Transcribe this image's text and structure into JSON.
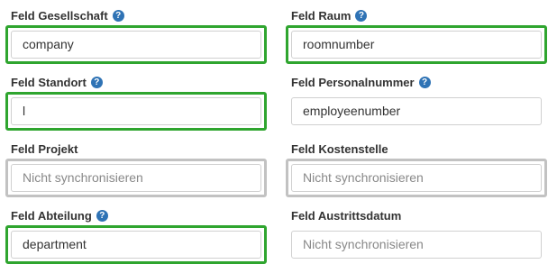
{
  "help_glyph": "?",
  "fields": {
    "gesellschaft": {
      "label": "Feld Gesellschaft",
      "value": "company",
      "has_help": true,
      "highlight": "green"
    },
    "raum": {
      "label": "Feld Raum",
      "value": "roomnumber",
      "has_help": true,
      "highlight": "green"
    },
    "standort": {
      "label": "Feld Standort",
      "value": "l",
      "has_help": true,
      "highlight": "green"
    },
    "personalnummer": {
      "label": "Feld Personalnummer",
      "value": "employeenumber",
      "has_help": true,
      "highlight": "none"
    },
    "projekt": {
      "label": "Feld Projekt",
      "placeholder": "Nicht synchronisieren",
      "highlight": "gray"
    },
    "kostenstelle": {
      "label": "Feld Kostenstelle",
      "placeholder": "Nicht synchronisieren",
      "highlight": "gray"
    },
    "abteilung": {
      "label": "Feld Abteilung",
      "value": "department",
      "has_help": true,
      "highlight": "green"
    },
    "austrittsdatum": {
      "label": "Feld Austrittsdatum",
      "placeholder": "Nicht synchronisieren",
      "highlight": "none"
    }
  },
  "colors": {
    "highlight_green": "#2fa52f",
    "highlight_gray": "#c2c2c2",
    "help_icon": "#2f73b5",
    "label_text": "#333333",
    "placeholder_text": "#888888"
  }
}
